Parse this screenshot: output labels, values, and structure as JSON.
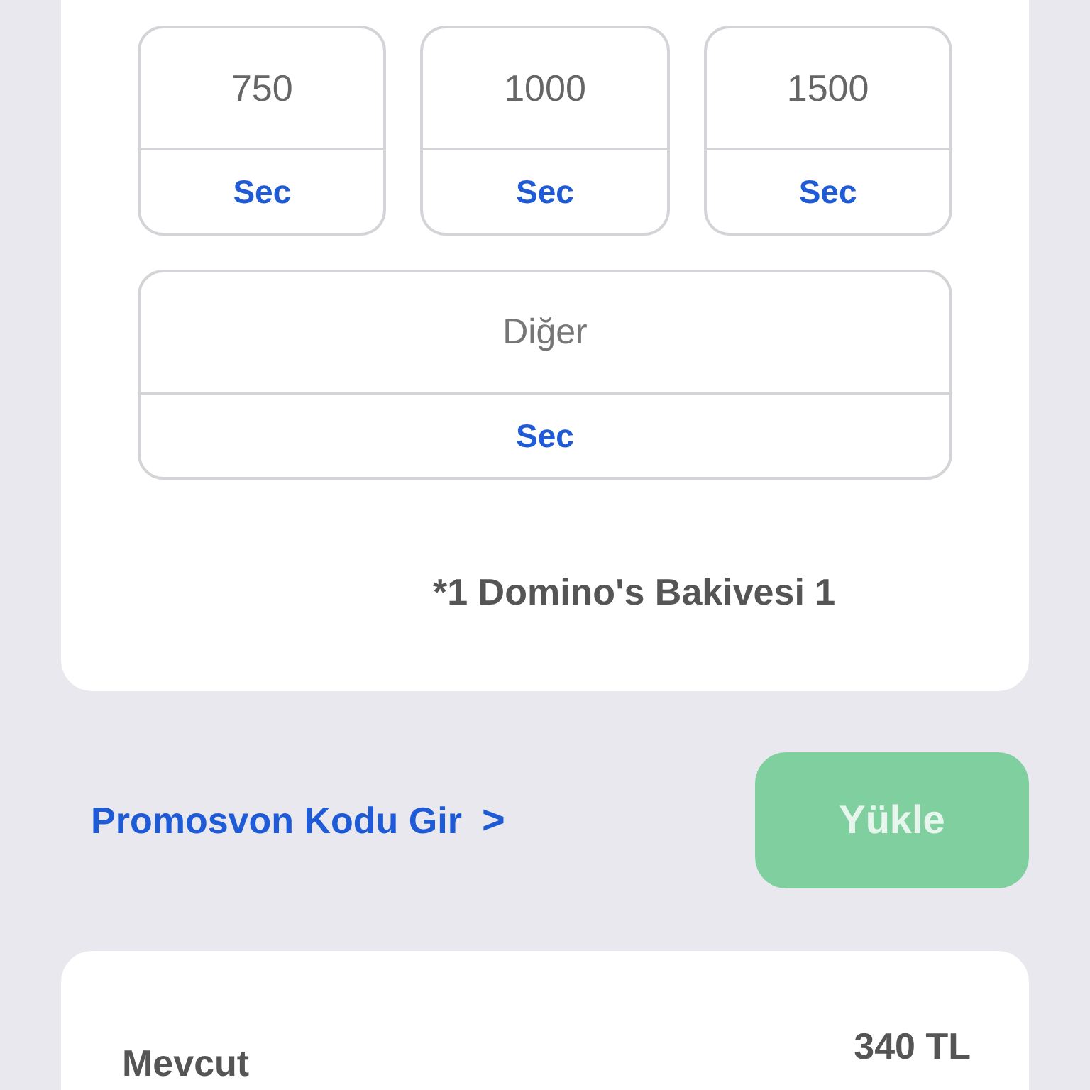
{
  "amounts": [
    {
      "value": "750",
      "action": "Sec"
    },
    {
      "value": "1000",
      "action": "Sec"
    },
    {
      "value": "1500",
      "action": "Sec"
    }
  ],
  "other": {
    "placeholder": "Diğer",
    "action": "Sec"
  },
  "footnote": "*1 Domino's Bakivesi 1",
  "promo_link": "Promosvon Kodu Gir",
  "promo_chevron": ">",
  "load_button": {
    "label": "Yükle",
    "disabled": true
  },
  "balance": {
    "label": "Mevcut",
    "value": "340 TL"
  }
}
